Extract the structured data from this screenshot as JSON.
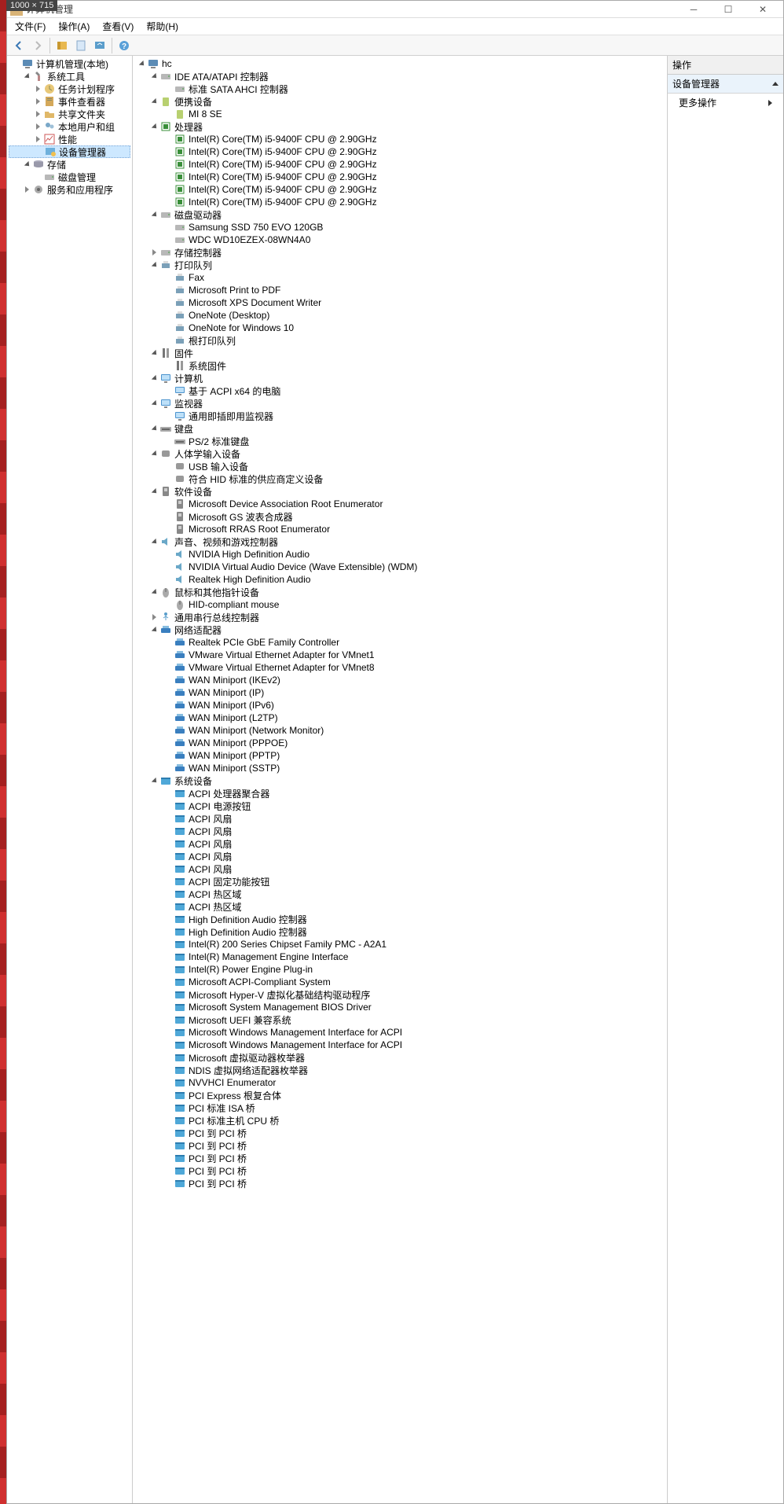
{
  "dim_badge": "1000 × 715",
  "window_title": "计算机管理",
  "menu": {
    "file": "文件(F)",
    "action": "操作(A)",
    "view": "查看(V)",
    "help": "帮助(H)"
  },
  "left_tree": {
    "root": "计算机管理(本地)",
    "group_sys": "系统工具",
    "task_sched": "任务计划程序",
    "event_viewer": "事件查看器",
    "shared_folders": "共享文件夹",
    "local_users": "本地用户和组",
    "perf": "性能",
    "dev_mgr": "设备管理器",
    "group_storage": "存储",
    "disk_mgmt": "磁盘管理",
    "group_svc": "服务和应用程序"
  },
  "right": {
    "header": "操作",
    "sub": "设备管理器",
    "more": "更多操作"
  },
  "devtree": {
    "root": "hc",
    "categories": [
      {
        "name": "IDE ATA/ATAPI 控制器",
        "state": "exp",
        "icon": "drv",
        "items": [
          "标准 SATA AHCI 控制器"
        ]
      },
      {
        "name": "便携设备",
        "state": "exp",
        "icon": "port",
        "items": [
          "MI 8 SE"
        ]
      },
      {
        "name": "处理器",
        "state": "exp",
        "icon": "cpu",
        "items": [
          "Intel(R) Core(TM) i5-9400F CPU @ 2.90GHz",
          "Intel(R) Core(TM) i5-9400F CPU @ 2.90GHz",
          "Intel(R) Core(TM) i5-9400F CPU @ 2.90GHz",
          "Intel(R) Core(TM) i5-9400F CPU @ 2.90GHz",
          "Intel(R) Core(TM) i5-9400F CPU @ 2.90GHz",
          "Intel(R) Core(TM) i5-9400F CPU @ 2.90GHz"
        ]
      },
      {
        "name": "磁盘驱动器",
        "state": "exp",
        "icon": "drv",
        "items": [
          "Samsung SSD 750 EVO 120GB",
          "WDC WD10EZEX-08WN4A0"
        ]
      },
      {
        "name": "存储控制器",
        "state": "col",
        "icon": "drv",
        "items": []
      },
      {
        "name": "打印队列",
        "state": "exp",
        "icon": "prn",
        "items": [
          "Fax",
          "Microsoft Print to PDF",
          "Microsoft XPS Document Writer",
          "OneNote (Desktop)",
          "OneNote for Windows 10",
          "根打印队列"
        ]
      },
      {
        "name": "固件",
        "state": "exp",
        "icon": "fw",
        "items": [
          "系统固件"
        ]
      },
      {
        "name": "计算机",
        "state": "exp",
        "icon": "monitor",
        "items": [
          "基于 ACPI x64 的电脑"
        ]
      },
      {
        "name": "监视器",
        "state": "exp",
        "icon": "monitor",
        "items": [
          "通用即插即用监视器"
        ]
      },
      {
        "name": "键盘",
        "state": "exp",
        "icon": "kb",
        "items": [
          "PS/2 标准键盘"
        ]
      },
      {
        "name": "人体学输入设备",
        "state": "exp",
        "icon": "hid",
        "items": [
          "USB 输入设备",
          "符合 HID 标准的供应商定义设备"
        ]
      },
      {
        "name": "软件设备",
        "state": "exp",
        "icon": "sw",
        "items": [
          "Microsoft Device Association Root Enumerator",
          "Microsoft GS 波表合成器",
          "Microsoft RRAS Root Enumerator"
        ]
      },
      {
        "name": "声音、视频和游戏控制器",
        "state": "exp",
        "icon": "snd",
        "items": [
          "NVIDIA High Definition Audio",
          "NVIDIA Virtual Audio Device (Wave Extensible) (WDM)",
          "Realtek High Definition Audio"
        ]
      },
      {
        "name": "鼠标和其他指针设备",
        "state": "exp",
        "icon": "mouse",
        "items": [
          "HID-compliant mouse"
        ]
      },
      {
        "name": "通用串行总线控制器",
        "state": "col",
        "icon": "usb",
        "items": []
      },
      {
        "name": "网络适配器",
        "state": "exp",
        "icon": "net",
        "items": [
          "Realtek PCIe GbE Family Controller",
          "VMware Virtual Ethernet Adapter for VMnet1",
          "VMware Virtual Ethernet Adapter for VMnet8",
          "WAN Miniport (IKEv2)",
          "WAN Miniport (IP)",
          "WAN Miniport (IPv6)",
          "WAN Miniport (L2TP)",
          "WAN Miniport (Network Monitor)",
          "WAN Miniport (PPPOE)",
          "WAN Miniport (PPTP)",
          "WAN Miniport (SSTP)"
        ]
      },
      {
        "name": "系统设备",
        "state": "exp",
        "icon": "sys",
        "items": [
          "ACPI 处理器聚合器",
          "ACPI 电源按钮",
          "ACPI 风扇",
          "ACPI 风扇",
          "ACPI 风扇",
          "ACPI 风扇",
          "ACPI 风扇",
          "ACPI 固定功能按钮",
          "ACPI 热区域",
          "ACPI 热区域",
          "High Definition Audio 控制器",
          "High Definition Audio 控制器",
          "Intel(R) 200 Series Chipset Family PMC - A2A1",
          "Intel(R) Management Engine Interface",
          "Intel(R) Power Engine Plug-in",
          "Microsoft ACPI-Compliant System",
          "Microsoft Hyper-V 虚拟化基础结构驱动程序",
          "Microsoft System Management BIOS Driver",
          "Microsoft UEFI 兼容系统",
          "Microsoft Windows Management Interface for ACPI",
          "Microsoft Windows Management Interface for ACPI",
          "Microsoft 虚拟驱动器枚举器",
          "NDIS 虚拟网络适配器枚举器",
          "NVVHCI Enumerator",
          "PCI Express 根复合体",
          "PCI 标准 ISA 桥",
          "PCI 标准主机 CPU 桥",
          "PCI 到 PCI 桥",
          "PCI 到 PCI 桥",
          "PCI 到 PCI 桥",
          "PCI 到 PCI 桥",
          "PCI 到 PCI 桥"
        ]
      }
    ]
  }
}
